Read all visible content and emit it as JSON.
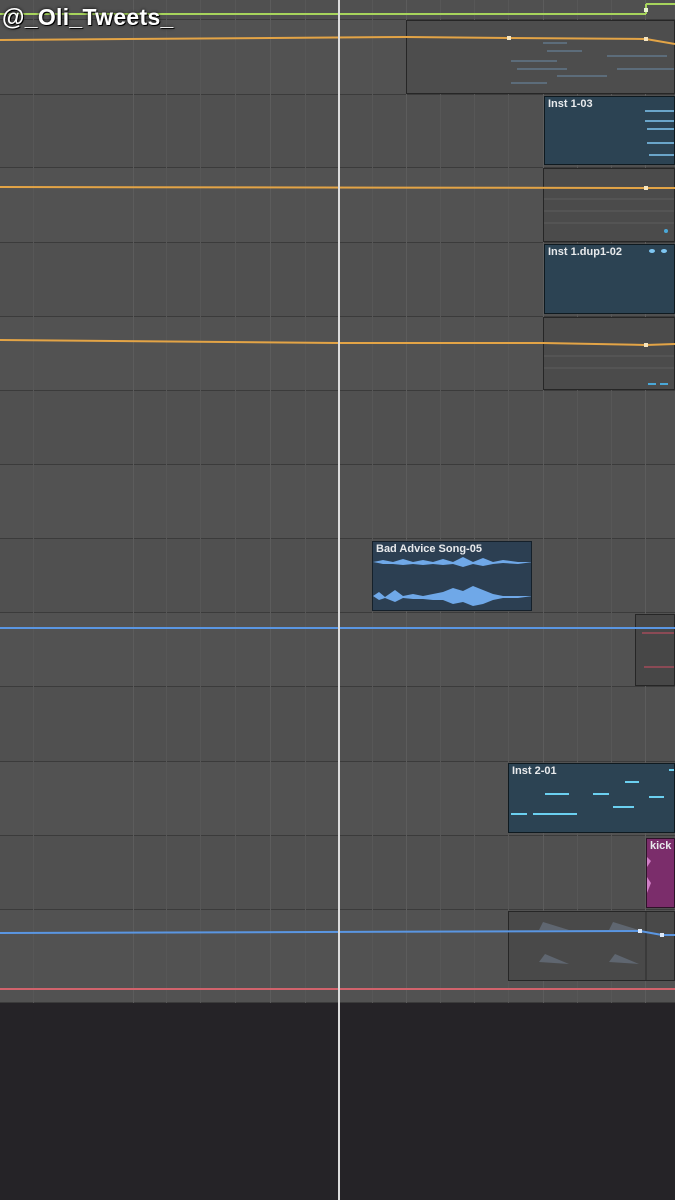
{
  "watermark": {
    "text": "@_Oli_Tweets_"
  },
  "regions": {
    "inst_1_03": {
      "label": "Inst 1-03"
    },
    "inst_1_dup1_02": {
      "label": "Inst 1.dup1-02"
    },
    "bad_advice": {
      "label": "Bad Advice Song-05"
    },
    "inst_2_01": {
      "label": "Inst 2-01"
    },
    "kick": {
      "label": "kick"
    }
  },
  "colors": {
    "lane_bg": "#505050",
    "automation_orange": "#e3a446",
    "automation_blue": "#5a96e2",
    "automation_green": "#a7d45c",
    "midi_region": "#2c4353",
    "drum_region": "#7b2d6b",
    "end_marker": "#d1636c",
    "playhead": "#dcdcdc"
  }
}
